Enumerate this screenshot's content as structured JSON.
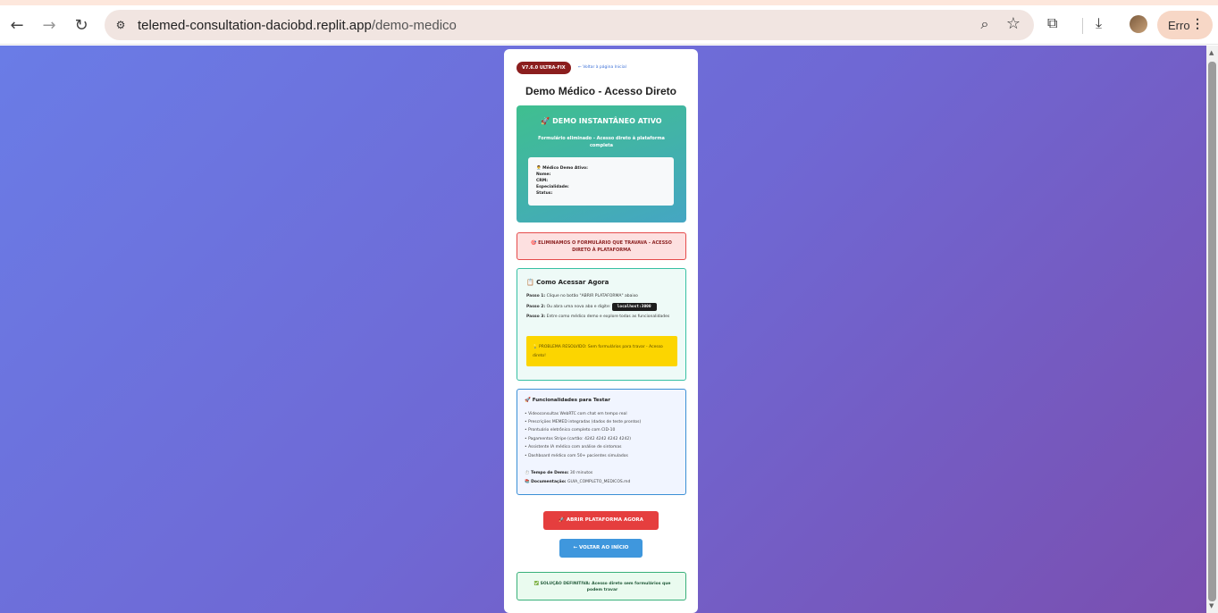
{
  "browser": {
    "url_host": "telemed-consultation-daciobd.replit.app",
    "url_path": "/demo-medico",
    "profile_label": "Erro",
    "icons": {
      "back": "back-arrow-icon",
      "forward": "forward-arrow-icon",
      "reload": "reload-icon",
      "site_info": "site-info-icon",
      "zoom": "zoom-icon",
      "bookmark": "star-icon",
      "extensions": "puzzle-icon",
      "download": "download-icon",
      "menu": "kebab-menu-icon"
    }
  },
  "card": {
    "version": "V7.6.0 ULTRA-FIX",
    "back_link": "← Voltar à página Inicial",
    "title": "Demo Médico - Acesso Direto"
  },
  "demo": {
    "title": "🚀 DEMO INSTANTÂNEO ATIVO",
    "subtitle": "Formulário eliminado - Acesso direto à plataforma completa",
    "doctor_header": "👨‍⚕️ Médico Demo Ativo:",
    "name_label": "Nome:",
    "crm_label": "CRM:",
    "specialty_label": "Especialidade:",
    "status_label": "Status:"
  },
  "warning": {
    "text": "🎯 ELIMINAMOS O FORMULÁRIO QUE TRAVAVA - ACESSO DIRETO À PLATAFORMA"
  },
  "how_to": {
    "title": "📋 Como Acessar Agora",
    "step1_label": "Passo 1:",
    "step1_text": "Clique no botão \"ABRIR PLATAFORMA\" abaixo",
    "step2_label": "Passo 2:",
    "step2_text": "Ou abra uma nova aba e digite:",
    "step2_code": "localhost:3000",
    "step3_label": "Passo 3:",
    "step3_text": "Entre como médico demo e explore todas as funcionalidades",
    "tip": "💡 PROBLEMA RESOLVIDO: Sem formulários para travar - Acesso direto!"
  },
  "features": {
    "title": "🚀 Funcionalidades para Testar",
    "items": [
      "• Videoconsultas WebRTC com chat em tempo real",
      "• Prescrições MEMED integradas (dados de teste prontos)",
      "• Prontuário eletrônico completo com CID-10",
      "• Pagamentos Stripe (cartão: 4242 4242 4242 4242)",
      "• Assistente IA médico com análise de sintomas",
      "• Dashboard médico com 50+ pacientes simulados"
    ],
    "time_label": "⏱️ Tempo de Demo:",
    "time_value": "30 minutos",
    "docs_label": "📚 Documentação:",
    "docs_value": "GUIA_COMPLETO_MEDICOS.md"
  },
  "actions": {
    "open_platform": "🚀 ABRIR PLATAFORMA AGORA",
    "back_home": "← VOLTAR AO INÍCIO"
  },
  "solution": {
    "text": "✅ SOLUÇÃO DEFINITIVA: Acesso direto sem formulários que podem travar"
  },
  "colors": {
    "bg_gradient_start": "#6a7ce6",
    "bg_gradient_end": "#7a4fb0",
    "demo_green": "#3fbf8f",
    "warning_red": "#e54b4b",
    "open_button": "#e53e3e",
    "back_button": "#3f97dd",
    "tip_yellow": "#fcd500"
  }
}
